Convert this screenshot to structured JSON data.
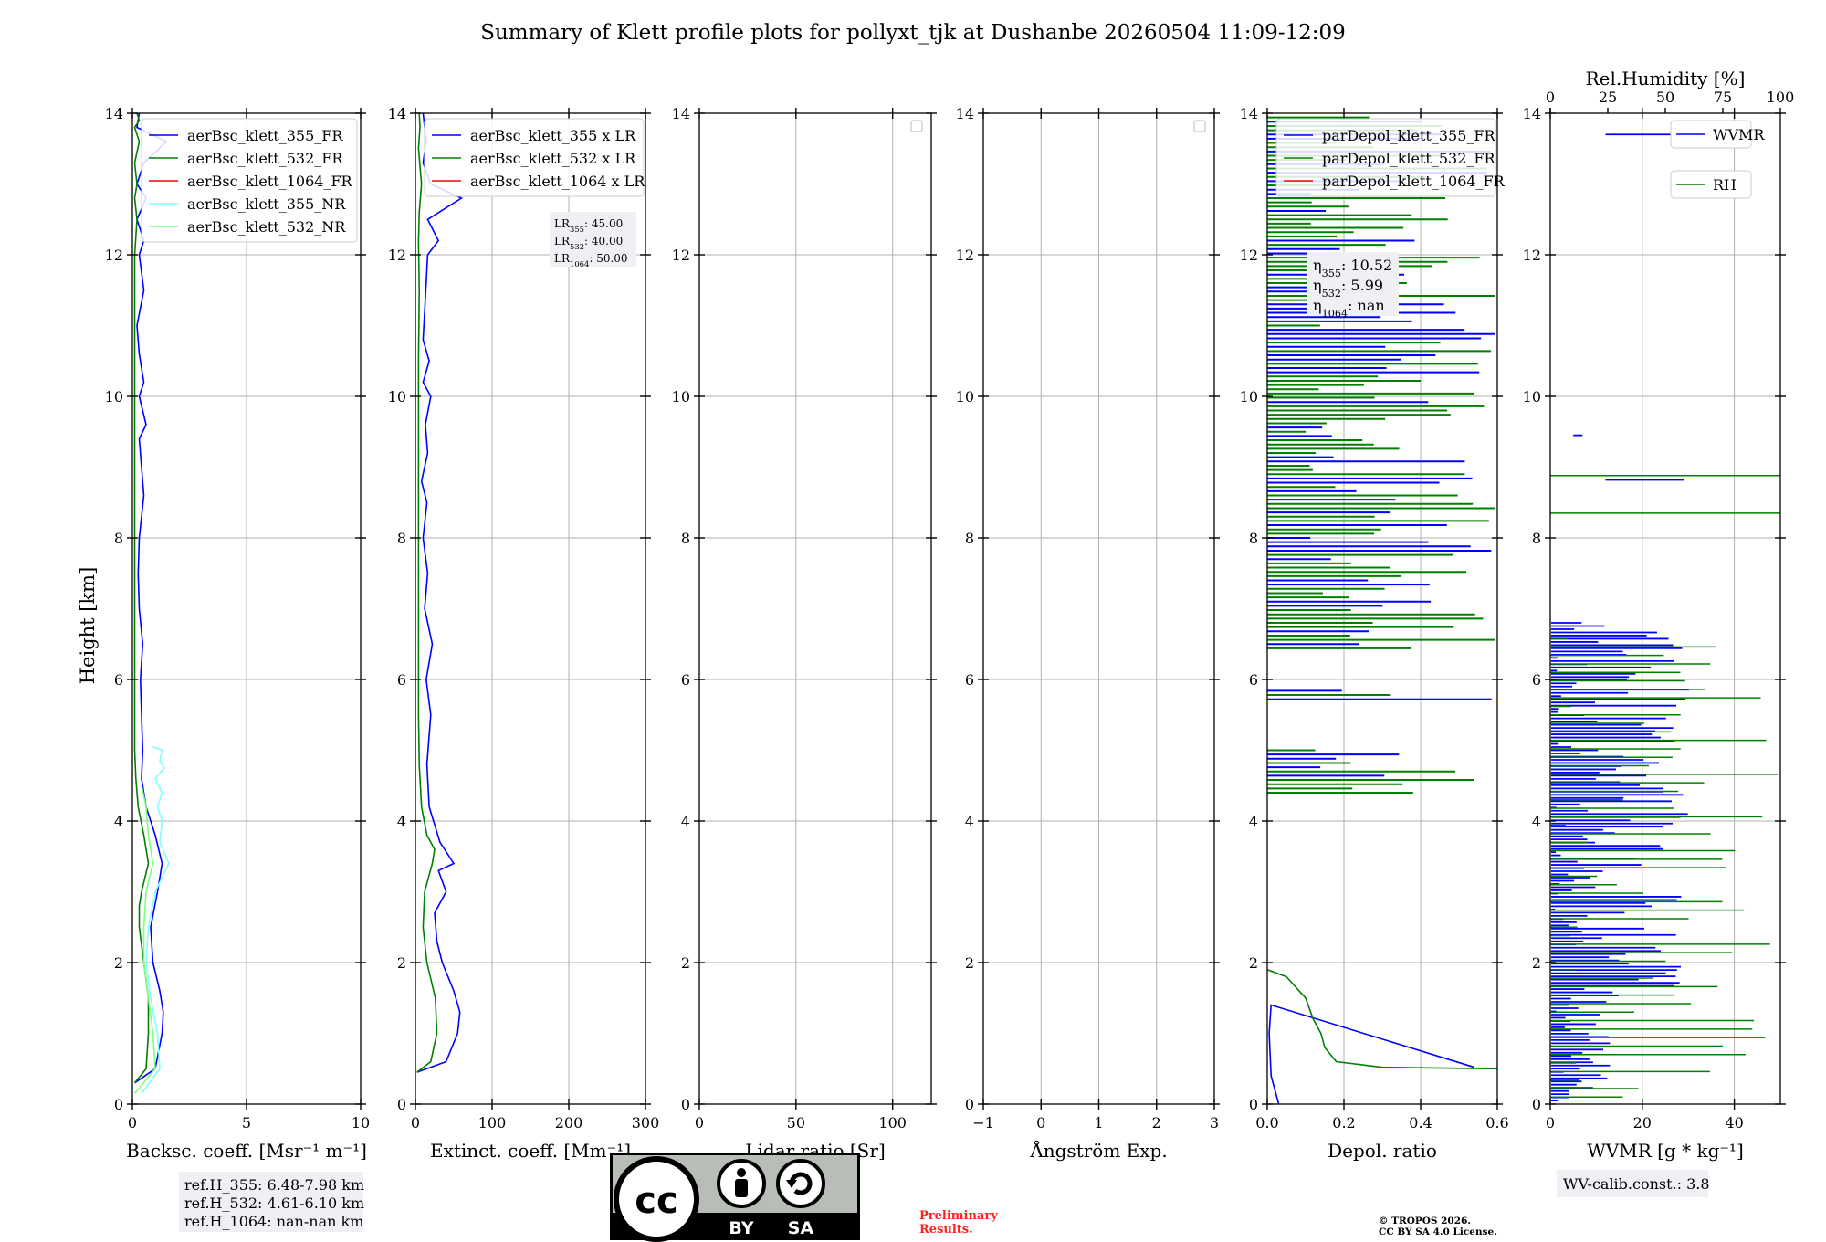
{
  "title": "Summary of Klett profile plots for pollyxt_tjk at Dushanbe 20260504 11:09-12:09",
  "ylabel": "Height [km]",
  "colors": {
    "c355": "#0000ff",
    "c532": "#008000",
    "c1064": "#ff0000",
    "c355nr": "#7fffff",
    "c532nr": "#7fff7f"
  },
  "chart_data": [
    {
      "type": "line",
      "name": "backscatter",
      "xlabel": "Backsc. coeff. [Msr⁻¹ m⁻¹]",
      "xlim": [
        0,
        10
      ],
      "ylim": [
        0,
        14
      ],
      "xticks": [
        "0",
        "5",
        "10"
      ],
      "yticks": [
        "0",
        "2",
        "4",
        "6",
        "8",
        "10",
        "12",
        "14"
      ],
      "grid": true,
      "legend_position": "top-left",
      "series": [
        {
          "name": "aerBsc_klett_355_FR",
          "color_key": "c355",
          "x": [
            0.1,
            1.0,
            1.3,
            1.35,
            1.2,
            0.9,
            0.8,
            1.1,
            1.3,
            1.0,
            0.6,
            0.4,
            0.45,
            0.4,
            0.35,
            0.45,
            0.3,
            0.25,
            0.3,
            0.5,
            0.4,
            0.3,
            0.6,
            0.3,
            0.5,
            0.3,
            0.2,
            0.5,
            0.3,
            0.5,
            0.2,
            0.6,
            0.2,
            0.5,
            1.5,
            0.2,
            0.3
          ],
          "y": [
            0.3,
            0.5,
            1.0,
            1.3,
            1.6,
            2.0,
            2.5,
            3.0,
            3.4,
            3.8,
            4.2,
            4.6,
            5.0,
            5.5,
            6.0,
            6.5,
            7.0,
            7.5,
            8.0,
            8.6,
            9.0,
            9.4,
            9.6,
            10.0,
            10.2,
            10.6,
            11.0,
            11.5,
            12.0,
            12.2,
            12.5,
            12.8,
            13.0,
            13.3,
            13.6,
            13.8,
            14.0
          ]
        },
        {
          "name": "aerBsc_klett_532_FR",
          "color_key": "c532",
          "x": [
            0.1,
            0.6,
            0.7,
            0.7,
            0.5,
            0.3,
            0.3,
            0.4,
            0.7,
            0.5,
            0.25,
            0.15,
            0.1,
            0.1,
            0.1,
            0.1,
            0.1,
            0.1,
            0.1,
            0.1,
            0.1,
            0.2,
            0.1,
            0.2,
            0.1,
            0.3,
            0.1,
            0.3,
            0.2
          ],
          "y": [
            0.3,
            0.5,
            1.0,
            1.5,
            2.0,
            2.5,
            2.8,
            3.0,
            3.4,
            3.8,
            4.2,
            4.6,
            5.0,
            6.0,
            7.0,
            8.0,
            9.0,
            10.0,
            11.0,
            11.5,
            12.0,
            12.5,
            12.8,
            13.0,
            13.3,
            13.6,
            13.8,
            13.9,
            14.0
          ]
        },
        {
          "name": "aerBsc_klett_1064_FR",
          "color_key": "c1064",
          "x": [],
          "y": []
        },
        {
          "name": "aerBsc_klett_355_NR",
          "color_key": "c355nr",
          "x": [
            0.4,
            1.2,
            1.1,
            0.8,
            0.6,
            0.7,
            1.0,
            1.6,
            1.2,
            1.3,
            1.1,
            1.3,
            1.0,
            1.4,
            1.2,
            1.3,
            0.9
          ],
          "y": [
            0.15,
            0.5,
            1.0,
            1.5,
            2.0,
            2.5,
            3.0,
            3.4,
            3.7,
            4.0,
            4.2,
            4.4,
            4.6,
            4.75,
            4.85,
            5.0,
            5.05
          ]
        },
        {
          "name": "aerBsc_klett_532_NR",
          "color_key": "c532nr",
          "x": [
            0.1,
            1.0,
            0.9,
            0.7,
            0.5,
            0.5,
            0.6,
            0.9,
            0.7,
            0.6,
            0.4
          ],
          "y": [
            0.15,
            0.5,
            1.0,
            1.5,
            2.0,
            2.5,
            3.0,
            3.4,
            3.8,
            4.2,
            4.5
          ]
        }
      ],
      "info_box": [
        "ref.H_355: 6.48-7.98 km",
        "ref.H_532: 4.61-6.10 km",
        "ref.H_1064: nan-nan km"
      ]
    },
    {
      "type": "line",
      "name": "extinction",
      "xlabel": "Extinct. coeff. [Mm⁻¹]",
      "xlim": [
        0,
        300
      ],
      "ylim": [
        0,
        14
      ],
      "xticks": [
        "0",
        "100",
        "200",
        "300"
      ],
      "yticks": [
        "0",
        "2",
        "4",
        "6",
        "8",
        "10",
        "12",
        "14"
      ],
      "grid": true,
      "legend_position": "top-left",
      "series": [
        {
          "name": "aerBsc_klett_355 x LR",
          "color_key": "c355",
          "x": [
            2,
            40,
            55,
            58,
            50,
            35,
            28,
            25,
            40,
            30,
            50,
            32,
            18,
            15,
            20,
            14,
            22,
            12,
            16,
            10,
            15,
            8,
            16,
            13,
            20,
            10,
            18,
            10,
            12,
            14,
            16,
            30,
            16,
            60,
            20,
            10,
            14,
            12,
            10
          ],
          "y": [
            0.45,
            0.6,
            1.0,
            1.3,
            1.6,
            2.0,
            2.3,
            2.7,
            3.0,
            3.3,
            3.4,
            3.7,
            4.2,
            4.8,
            5.5,
            6.0,
            6.5,
            7.0,
            7.5,
            8.0,
            8.5,
            8.8,
            9.2,
            9.6,
            10.0,
            10.2,
            10.5,
            10.8,
            11.2,
            11.6,
            12.0,
            12.2,
            12.5,
            12.8,
            13.0,
            13.3,
            13.6,
            13.8,
            14.0
          ]
        },
        {
          "name": "aerBsc_klett_532 x LR",
          "color_key": "c532",
          "x": [
            2,
            20,
            28,
            26,
            15,
            10,
            12,
            22,
            25,
            15,
            8,
            5,
            4,
            4,
            4,
            4,
            4,
            4,
            5,
            4,
            5,
            8,
            4,
            6,
            5
          ],
          "y": [
            0.45,
            0.6,
            1.0,
            1.5,
            2.0,
            2.5,
            3.0,
            3.4,
            3.6,
            3.8,
            4.2,
            4.8,
            5.5,
            6.5,
            7.5,
            8.5,
            9.5,
            10.5,
            11.5,
            12.2,
            12.6,
            13.0,
            13.5,
            13.8,
            14.0
          ]
        },
        {
          "name": "aerBsc_klett_1064 x LR",
          "color_key": "c1064",
          "x": [],
          "y": []
        }
      ],
      "lr_box": [
        {
          "sub": "355",
          "value": "45.00"
        },
        {
          "sub": "532",
          "value": "40.00"
        },
        {
          "sub": "1064",
          "value": "50.00"
        }
      ]
    },
    {
      "type": "line",
      "name": "lidar-ratio",
      "xlabel": "Lidar ratio [Sr]",
      "xlim": [
        0,
        120
      ],
      "ylim": [
        0,
        14
      ],
      "xticks": [
        "0",
        "50",
        "100"
      ],
      "yticks": [
        "0",
        "2",
        "4",
        "6",
        "8",
        "10",
        "12",
        "14"
      ],
      "grid": true,
      "legend_position": "top-right",
      "series": []
    },
    {
      "type": "line",
      "name": "angstrom",
      "xlabel": "Ångström Exp.",
      "xlim": [
        -1,
        3
      ],
      "ylim": [
        0,
        14
      ],
      "xticks": [
        "−1",
        "0",
        "1",
        "2",
        "3"
      ],
      "yticks": [
        "0",
        "2",
        "4",
        "6",
        "8",
        "10",
        "12",
        "14"
      ],
      "grid": true,
      "legend_position": "top-right",
      "series": []
    },
    {
      "type": "line",
      "name": "depol",
      "xlabel": "Depol. ratio",
      "xlim": [
        0,
        0.6
      ],
      "ylim": [
        0,
        14
      ],
      "xticks": [
        "0.0",
        "0.2",
        "0.4",
        "0.6"
      ],
      "yticks": [
        "0",
        "2",
        "4",
        "6",
        "8",
        "10",
        "12",
        "14"
      ],
      "grid": true,
      "legend_position": "top-left",
      "series": [
        {
          "name": "parDepol_klett_355_FR",
          "color_key": "c355",
          "x": [
            0.03,
            0.025,
            0.02,
            0.015,
            0.01,
            0.005,
            0.01,
            0.54
          ],
          "y": [
            0.0,
            0.1,
            0.2,
            0.3,
            0.4,
            1.0,
            1.4,
            0.52
          ]
        },
        {
          "name": "parDepol_klett_532_FR",
          "color_key": "c532",
          "x": [
            0.0,
            0.05,
            0.1,
            0.12,
            0.14,
            0.15,
            0.18,
            0.3,
            0.6
          ],
          "y": [
            1.9,
            1.8,
            1.5,
            1.2,
            1.0,
            0.8,
            0.6,
            0.52,
            0.5
          ]
        },
        {
          "name": "parDepol_klett_1064_FR",
          "color_key": "c1064",
          "x": [],
          "y": []
        }
      ],
      "eta_box": [
        {
          "sub": "355",
          "value": "10.52"
        },
        {
          "sub": "532",
          "value": "5.99"
        },
        {
          "sub": "1064",
          "value": "nan"
        }
      ]
    },
    {
      "type": "line",
      "name": "wvmr",
      "xlabel": "WVMR [g * kg⁻¹]",
      "xlim": [
        0,
        50
      ],
      "ylim": [
        0,
        14
      ],
      "xticks": [
        "0",
        "20",
        "40"
      ],
      "yticks": [
        "0",
        "2",
        "4",
        "6",
        "8",
        "10",
        "12",
        "14"
      ],
      "top_xlabel": "Rel.Humidity [%]",
      "top_xlim": [
        0,
        100
      ],
      "top_xticks": [
        "0",
        "25",
        "50",
        "75",
        "100"
      ],
      "grid": true,
      "series": [
        {
          "name": "WVMR",
          "color_key": "c355"
        },
        {
          "name": "RH",
          "color_key": "c532"
        }
      ],
      "info_box": [
        "WV-calib.const.: 3.8"
      ]
    }
  ],
  "badge": {
    "cc": "cc",
    "by": "BY",
    "sa": "SA"
  },
  "preliminary": [
    "Preliminary",
    "Results."
  ],
  "copyright": [
    "© TROPOS 2026.",
    "CC BY SA 4.0 License."
  ]
}
